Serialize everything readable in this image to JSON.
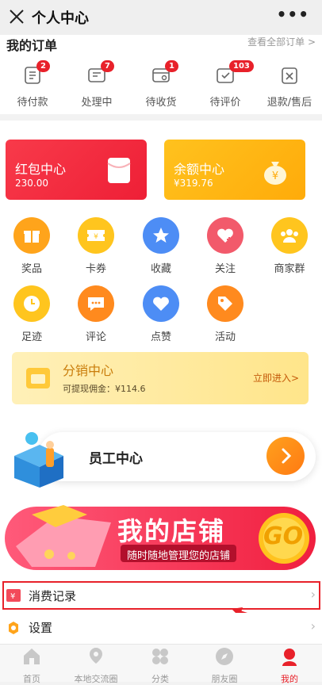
{
  "header": {
    "title": "个人中心",
    "more": "•••"
  },
  "orders": {
    "title": "我的订单",
    "view_all": "查看全部订单 >",
    "items": [
      {
        "label": "待付款",
        "badge": "2"
      },
      {
        "label": "处理中",
        "badge": "7"
      },
      {
        "label": "待收货",
        "badge": "1"
      },
      {
        "label": "待评价",
        "badge": "103"
      },
      {
        "label": "退款/售后",
        "badge": ""
      }
    ]
  },
  "cards": {
    "redpacket": {
      "title": "红包中心",
      "value": "230.00"
    },
    "balance": {
      "title": "余额中心",
      "value": "¥319.76"
    }
  },
  "grid": [
    {
      "label": "奖品",
      "icon": "gift-icon",
      "color": "#ffa41b"
    },
    {
      "label": "卡券",
      "icon": "ticket-icon",
      "color": "#ffc51e"
    },
    {
      "label": "收藏",
      "icon": "star-icon",
      "color": "#4d8df5"
    },
    {
      "label": "关注",
      "icon": "heart-plus-icon",
      "color": "#f25a6b"
    },
    {
      "label": "商家群",
      "icon": "group-icon",
      "color": "#ffc51e"
    },
    {
      "label": "足迹",
      "icon": "clock-icon",
      "color": "#ffc51e"
    },
    {
      "label": "评论",
      "icon": "comment-icon",
      "color": "#ff8a1e"
    },
    {
      "label": "点赞",
      "icon": "heart-icon",
      "color": "#4d8df5"
    },
    {
      "label": "活动",
      "icon": "tag-icon",
      "color": "#ff8a1e"
    }
  ],
  "distribution": {
    "title": "分销中心",
    "subtitle": "可提现佣金：¥114.6",
    "enter": "立即进入>"
  },
  "staff": {
    "title": "员工中心"
  },
  "shop_banner": {
    "title": "我的店铺",
    "subtitle": "随时随地管理您的店铺",
    "go": "GO"
  },
  "menu": [
    {
      "label": "消费记录"
    },
    {
      "label": "设置"
    }
  ],
  "tabbar": [
    {
      "label": "首页"
    },
    {
      "label": "本地交流圈"
    },
    {
      "label": "分类"
    },
    {
      "label": "朋友圈"
    },
    {
      "label": "我的"
    }
  ]
}
